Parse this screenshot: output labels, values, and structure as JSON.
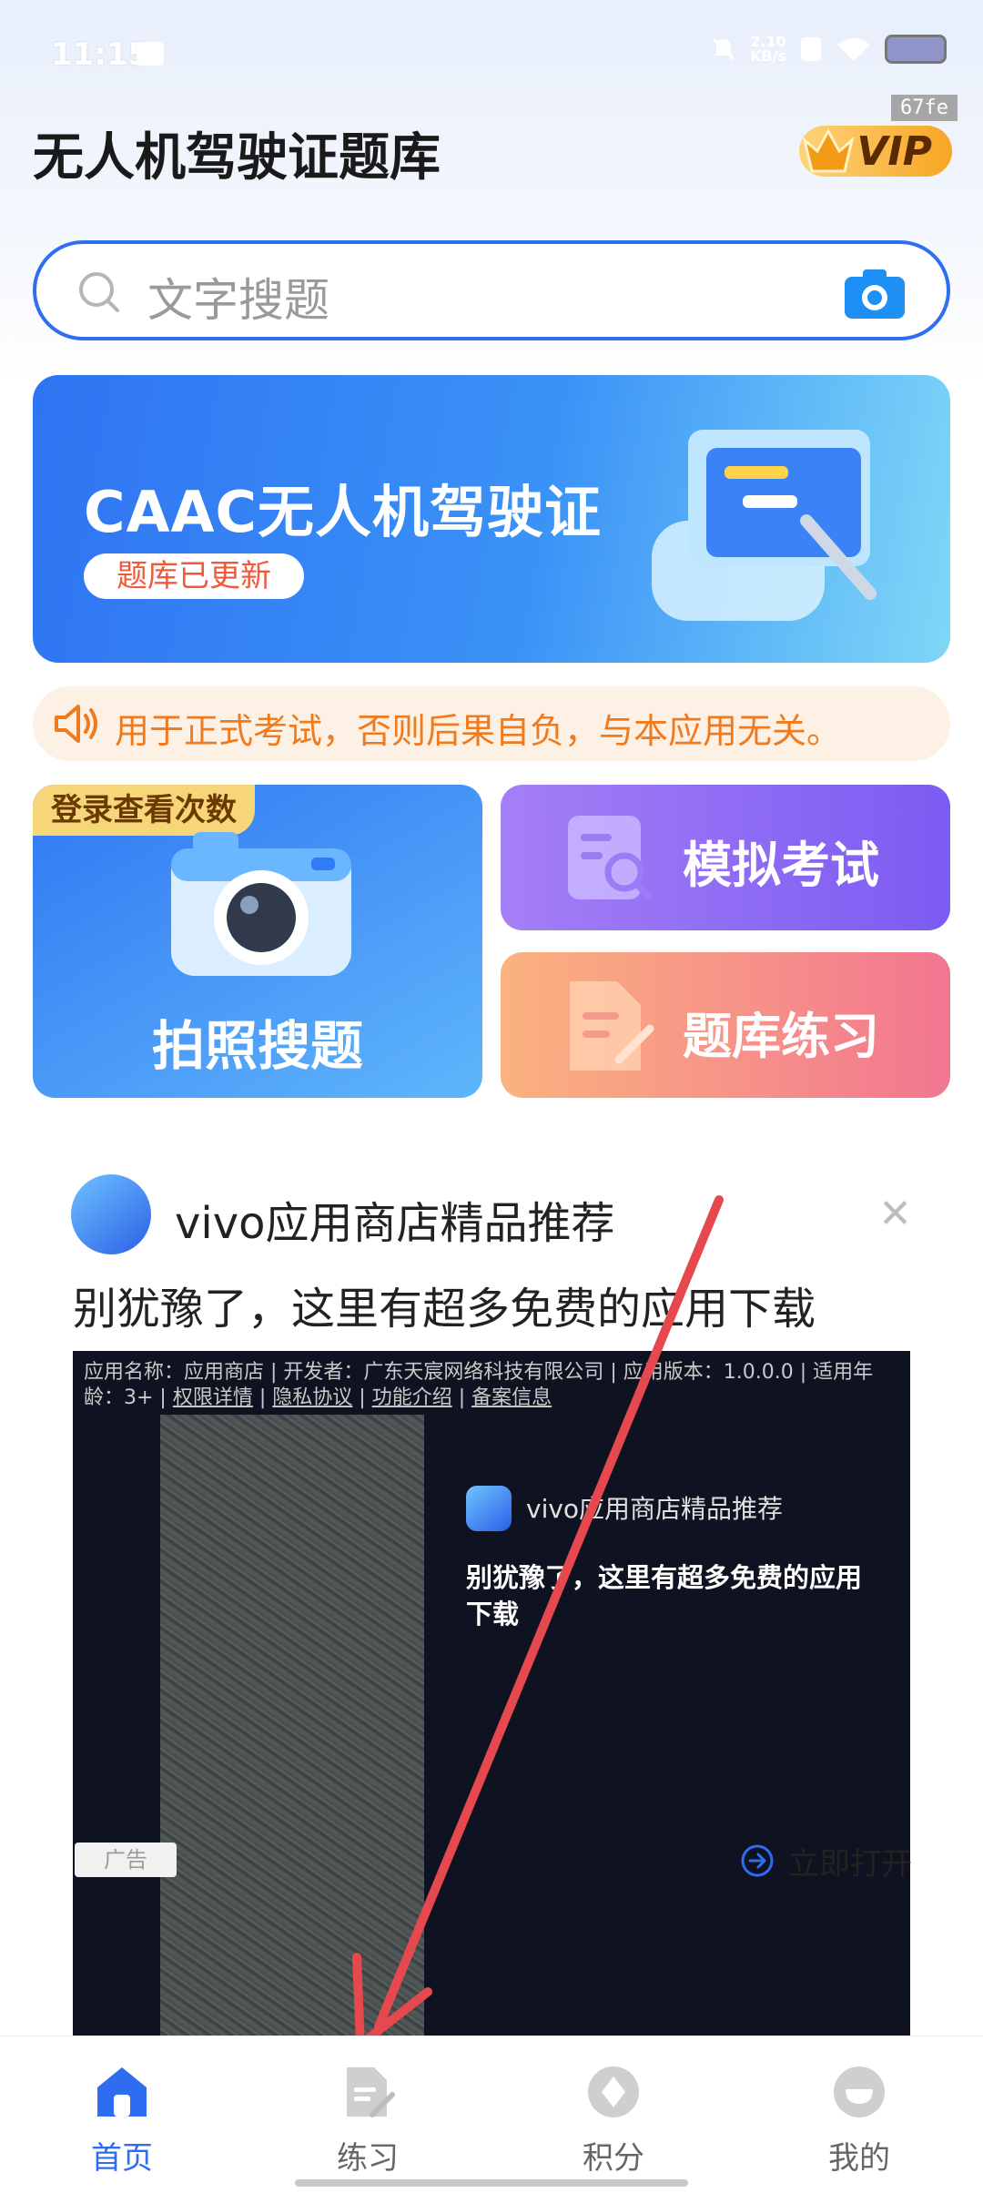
{
  "status_bar": {
    "time": "11:15",
    "net_speed_value": "2.10",
    "net_speed_unit": "KB/s"
  },
  "overlay_hash": "67fe",
  "header": {
    "title": "无人机驾驶证题库",
    "vip_label": "VIP"
  },
  "search": {
    "placeholder": "文字搜题"
  },
  "banner": {
    "title": "CAAC无人机驾驶证",
    "tag": "题库已更新"
  },
  "notice": {
    "text": "用于正式考试，否则后果自负，与本应用无关。"
  },
  "cards": {
    "photo": {
      "tag": "登录查看次数",
      "label": "拍照搜题"
    },
    "mock_exam": {
      "label": "模拟考试"
    },
    "practice": {
      "label": "题库练习"
    }
  },
  "ad": {
    "title": "vivo应用商店精品推荐",
    "subtitle": "别犹豫了，这里有超多免费的应用下载",
    "meta_prefix": "应用名称：应用商店 | 开发者：广东天宸网络科技有限公司 | 应用版本：1.0.0.0 | 适用年龄：3+ | ",
    "meta_links": [
      "权限详情",
      "隐私协议",
      "功能介绍",
      "备案信息"
    ],
    "inner_title": "vivo应用商店精品推荐",
    "inner_text_line1": "别犹豫了，这里有超多免费的应用",
    "inner_text_line2": "下载",
    "ad_tag": "广告",
    "open_label": "立即打开"
  },
  "tabbar": {
    "items": [
      {
        "label": "首页",
        "icon": "home-icon",
        "active": true
      },
      {
        "label": "练习",
        "icon": "practice-icon",
        "active": false
      },
      {
        "label": "积分",
        "icon": "points-icon",
        "active": false
      },
      {
        "label": "我的",
        "icon": "profile-icon",
        "active": false
      }
    ]
  },
  "colors": {
    "accent": "#2e6cf1",
    "notice": "#f07a1e",
    "arrow": "#e5484d"
  }
}
